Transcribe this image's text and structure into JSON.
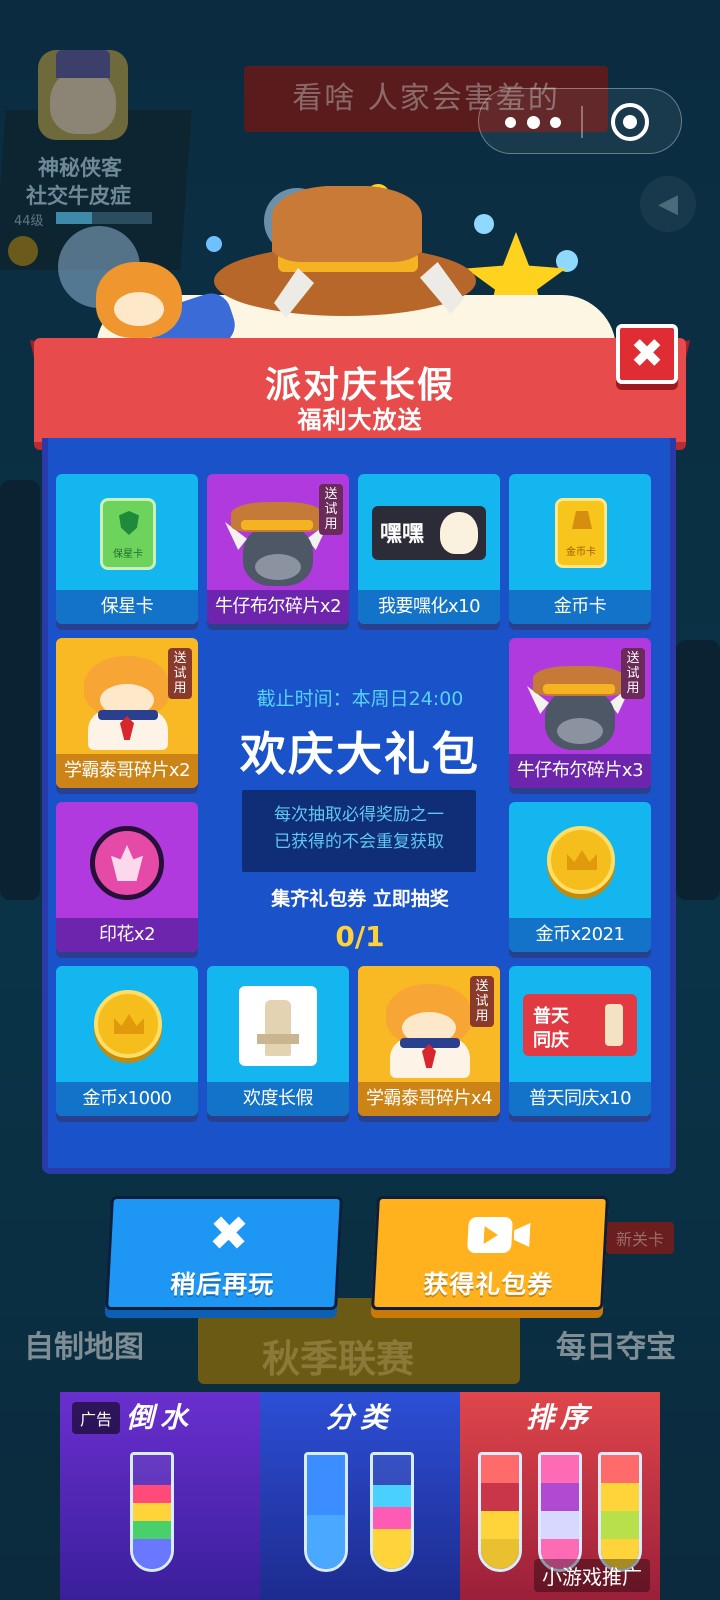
{
  "background": {
    "banner_text": "看啥 人家会害羞的",
    "player_name": "神秘侠客",
    "player_title": "社交牛皮症",
    "player_level": "44级",
    "level_progress": 0.38,
    "speaker_icon": "speaker-icon",
    "labels": {
      "custom_map": "自制地图",
      "autumn_league": "秋季联赛",
      "daily_treasure": "每日夺宝",
      "new_level": "新关卡"
    }
  },
  "capsule": {
    "more_icon": "more-dots-icon",
    "close_icon": "target-icon"
  },
  "modal": {
    "title": "派对庆长假",
    "subtitle": "福利大放送",
    "close_glyph": "✖",
    "trial_tag": "送试用",
    "deadline": "截止时间：本周日24:00",
    "main_title": "欢庆大礼包",
    "rule_line1": "每次抽取必得奖励之一",
    "rule_line2": "已获得的不会重复获取",
    "collect_text": "集齐礼包券 立即抽奖",
    "progress": "0/1",
    "items": [
      {
        "label": "保星卡",
        "card_text": "保星卡"
      },
      {
        "label": "牛仔布尔碎片x2"
      },
      {
        "label": "我要嘿化x10",
        "card_text": "嘿嘿"
      },
      {
        "label": "金币卡",
        "card_text": "金币卡"
      },
      {
        "label": "学霸泰哥碎片x2"
      },
      {
        "label": "牛仔布尔碎片x3"
      },
      {
        "label": "印花x2"
      },
      {
        "label": "金币x2021"
      },
      {
        "label": "金币x1000"
      },
      {
        "label": "欢度长假"
      },
      {
        "label": "学霸泰哥碎片x4"
      },
      {
        "label": "普天同庆x10",
        "card_text1": "普天",
        "card_text2": "同庆"
      }
    ],
    "buttons": {
      "later": "稍后再玩",
      "get": "获得礼包券",
      "later_glyph": "✖"
    }
  },
  "ad": {
    "tag": "广告",
    "col1": "倒水",
    "col2": "分类",
    "col3": "排序",
    "credit": "小游戏推广"
  },
  "colors": {
    "panel": "#1a52c9",
    "ribbon": "#e74b4b",
    "cell_cyan": "#13b6ee",
    "cell_purple": "#b13adf",
    "cell_yellow": "#f8b925",
    "btn_later": "#1d96f4",
    "btn_get": "#ffb21e"
  }
}
